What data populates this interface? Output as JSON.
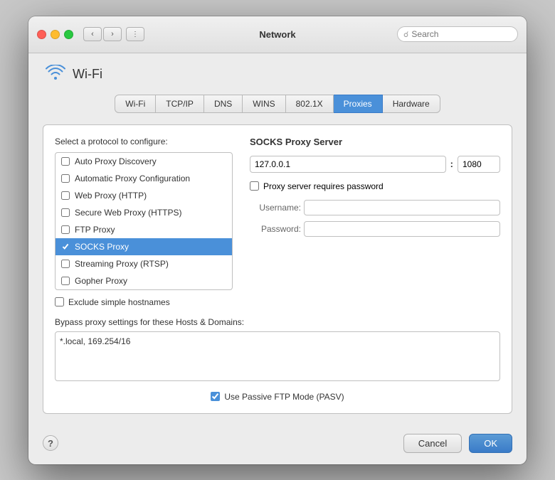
{
  "titlebar": {
    "title": "Network",
    "search_placeholder": "Search"
  },
  "wifi_header": {
    "label": "Wi-Fi"
  },
  "tabs": [
    {
      "label": "Wi-Fi",
      "active": false
    },
    {
      "label": "TCP/IP",
      "active": false
    },
    {
      "label": "DNS",
      "active": false
    },
    {
      "label": "WINS",
      "active": false
    },
    {
      "label": "802.1X",
      "active": false
    },
    {
      "label": "Proxies",
      "active": true
    },
    {
      "label": "Hardware",
      "active": false
    }
  ],
  "protocol_section": {
    "label": "Select a protocol to configure:",
    "items": [
      {
        "label": "Auto Proxy Discovery",
        "checked": false,
        "selected": false
      },
      {
        "label": "Automatic Proxy Configuration",
        "checked": false,
        "selected": false
      },
      {
        "label": "Web Proxy (HTTP)",
        "checked": false,
        "selected": false
      },
      {
        "label": "Secure Web Proxy (HTTPS)",
        "checked": false,
        "selected": false
      },
      {
        "label": "FTP Proxy",
        "checked": false,
        "selected": false
      },
      {
        "label": "SOCKS Proxy",
        "checked": true,
        "selected": true
      },
      {
        "label": "Streaming Proxy (RTSP)",
        "checked": false,
        "selected": false
      },
      {
        "label": "Gopher Proxy",
        "checked": false,
        "selected": false
      }
    ],
    "exclude_label": "Exclude simple hostnames"
  },
  "socks_server": {
    "title": "SOCKS Proxy Server",
    "host": "127.0.0.1",
    "port": "1080",
    "password_label": "Proxy server requires password",
    "username_label": "Username:",
    "password_field_label": "Password:",
    "username_value": "",
    "password_value": ""
  },
  "bypass": {
    "label": "Bypass proxy settings for these Hosts & Domains:",
    "value": "*.local, 169.254/16"
  },
  "pasv": {
    "label": "Use Passive FTP Mode (PASV)",
    "checked": true
  },
  "buttons": {
    "cancel": "Cancel",
    "ok": "OK",
    "help": "?"
  }
}
